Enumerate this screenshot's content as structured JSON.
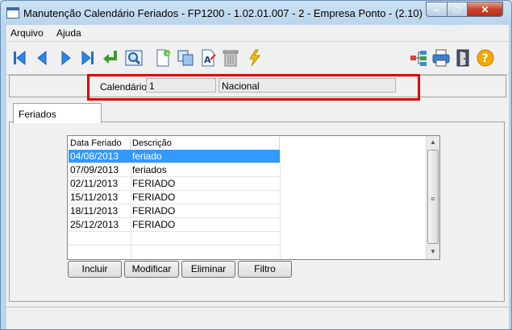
{
  "window": {
    "title": "Manutenção Calendário Feriados - FP1200 - 1.02.01.007 - 2 - Empresa Ponto - (2.10)",
    "min_glyph": "–",
    "max_glyph": "□",
    "close_glyph": "✕"
  },
  "menu": {
    "items": [
      {
        "label": "Arquivo"
      },
      {
        "label": "Ajuda"
      }
    ]
  },
  "toolbar": {
    "icons": [
      "first-icon",
      "prev-icon",
      "next-icon",
      "last-icon",
      "return-icon",
      "zoom-icon",
      "new-icon",
      "copy-icon",
      "edit-icon",
      "delete-icon",
      "execute-icon",
      "tree-icon",
      "print-icon",
      "exit-icon",
      "help-icon"
    ]
  },
  "header": {
    "calendar_label": "Calendário:",
    "calendar_code": "1",
    "calendar_desc": "Nacional"
  },
  "tabs": [
    {
      "label": "Feriados"
    }
  ],
  "grid": {
    "columns": [
      "Data Feriado",
      "Descrição"
    ],
    "rows": [
      {
        "date": "04/08/2013",
        "desc": "feriado",
        "selected": true
      },
      {
        "date": "07/09/2013",
        "desc": "feriados",
        "selected": false
      },
      {
        "date": "02/11/2013",
        "desc": "FERIADO",
        "selected": false
      },
      {
        "date": "15/11/2013",
        "desc": "FERIADO",
        "selected": false
      },
      {
        "date": "18/11/2013",
        "desc": "FERIADO",
        "selected": false
      },
      {
        "date": "25/12/2013",
        "desc": "FERIADO",
        "selected": false
      }
    ]
  },
  "buttons": {
    "incluir": "Incluir",
    "modificar": "Modificar",
    "eliminar": "Eliminar",
    "filtro": "Filtro"
  },
  "colors": {
    "accent_red": "#e00000",
    "selection": "#3399ff"
  }
}
